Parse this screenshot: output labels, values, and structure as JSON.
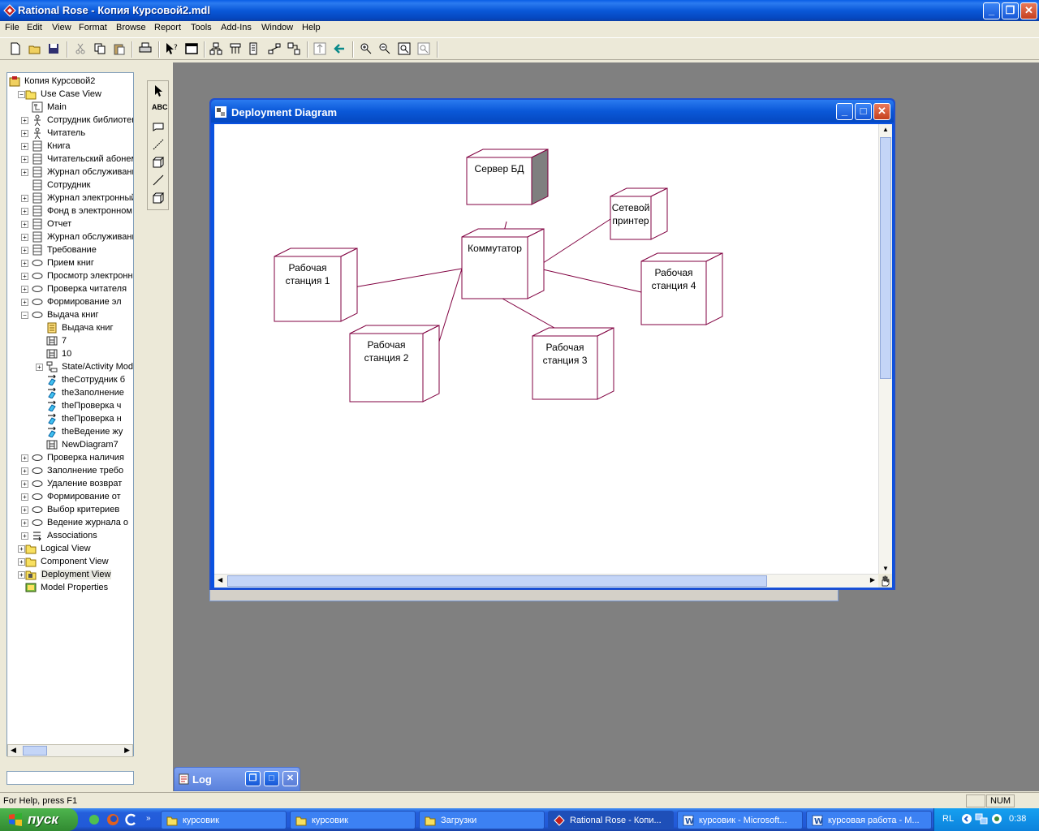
{
  "window": {
    "title": "Rational Rose - Копия Курсовой2.mdl"
  },
  "menu": [
    "File",
    "Edit",
    "View",
    "Format",
    "Browse",
    "Report",
    "Tools",
    "Add-Ins",
    "Window",
    "Help"
  ],
  "browser": {
    "items": [
      {
        "label": "Копия Курсовой2",
        "level": 0,
        "icon": "model-icon",
        "expander": ""
      },
      {
        "label": "Use Case View",
        "level": 1,
        "icon": "folder-icon",
        "expander": "−"
      },
      {
        "label": "Main",
        "level": 2,
        "icon": "diagram-icon",
        "expander": ""
      },
      {
        "label": "Сотрудник библиотеки",
        "level": 2,
        "icon": "actor-icon",
        "expander": "+"
      },
      {
        "label": "Читатель",
        "level": 2,
        "icon": "actor-icon",
        "expander": "+"
      },
      {
        "label": "Книга",
        "level": 2,
        "icon": "class-icon",
        "expander": "+"
      },
      {
        "label": "Читательский абонемент",
        "level": 2,
        "icon": "class-icon",
        "expander": "+"
      },
      {
        "label": "Журнал обслуживания",
        "level": 2,
        "icon": "class-icon",
        "expander": "+"
      },
      {
        "label": "Сотрудник",
        "level": 2,
        "icon": "class-icon",
        "expander": ""
      },
      {
        "label": "Журнал электронный",
        "level": 2,
        "icon": "class-icon",
        "expander": "+"
      },
      {
        "label": "Фонд в электронном",
        "level": 2,
        "icon": "class-icon",
        "expander": "+"
      },
      {
        "label": "Отчет",
        "level": 2,
        "icon": "class-icon",
        "expander": "+"
      },
      {
        "label": "Журнал обслуживания",
        "level": 2,
        "icon": "class-icon",
        "expander": "+"
      },
      {
        "label": "Требование",
        "level": 2,
        "icon": "class-icon",
        "expander": "+"
      },
      {
        "label": "Прием книг",
        "level": 2,
        "icon": "usecase-icon",
        "expander": "+"
      },
      {
        "label": "Просмотр электронного",
        "level": 2,
        "icon": "usecase-icon",
        "expander": "+"
      },
      {
        "label": "Проверка читателя",
        "level": 2,
        "icon": "usecase-icon",
        "expander": "+"
      },
      {
        "label": "Формирование эл",
        "level": 2,
        "icon": "usecase-icon",
        "expander": "+"
      },
      {
        "label": "Выдача книг",
        "level": 2,
        "icon": "usecase-icon",
        "expander": "−"
      },
      {
        "label": "Выдача книг",
        "level": 3,
        "icon": "doc-icon",
        "expander": ""
      },
      {
        "label": "7",
        "level": 3,
        "icon": "sequence-icon",
        "expander": ""
      },
      {
        "label": "10",
        "level": 3,
        "icon": "sequence-icon",
        "expander": ""
      },
      {
        "label": "State/Activity Model",
        "level": 3,
        "icon": "state-icon",
        "expander": "+"
      },
      {
        "label": "theСотрудник б",
        "level": 3,
        "icon": "link-icon",
        "expander": ""
      },
      {
        "label": "theЗаполнение",
        "level": 3,
        "icon": "link-icon",
        "expander": ""
      },
      {
        "label": "theПроверка ч",
        "level": 3,
        "icon": "link-icon",
        "expander": ""
      },
      {
        "label": "theПроверка н",
        "level": 3,
        "icon": "link-icon",
        "expander": ""
      },
      {
        "label": "theВедение жу",
        "level": 3,
        "icon": "link-icon",
        "expander": ""
      },
      {
        "label": "NewDiagram7",
        "level": 3,
        "icon": "sequence-icon",
        "expander": ""
      },
      {
        "label": "Проверка наличия",
        "level": 2,
        "icon": "usecase-icon",
        "expander": "+"
      },
      {
        "label": "Заполнение требо",
        "level": 2,
        "icon": "usecase-icon",
        "expander": "+"
      },
      {
        "label": "Удаление возврат",
        "level": 2,
        "icon": "usecase-icon",
        "expander": "+"
      },
      {
        "label": "Формирование от",
        "level": 2,
        "icon": "usecase-icon",
        "expander": "+"
      },
      {
        "label": "Выбор критериев",
        "level": 2,
        "icon": "usecase-icon",
        "expander": "+"
      },
      {
        "label": "Ведение журнала о",
        "level": 2,
        "icon": "usecase-icon",
        "expander": "+"
      },
      {
        "label": "Associations",
        "level": 2,
        "icon": "association-icon",
        "expander": "+"
      },
      {
        "label": "Logical View",
        "level": 1,
        "icon": "folder-icon",
        "expander": "+"
      },
      {
        "label": "Component View",
        "level": 1,
        "icon": "folder-icon",
        "expander": "+"
      },
      {
        "label": "Deployment View",
        "level": 1,
        "icon": "deploy-folder-icon",
        "expander": "+"
      },
      {
        "label": "Model Properties",
        "level": 1,
        "icon": "properties-icon",
        "expander": ""
      }
    ]
  },
  "palette": {
    "text_tool": "ABC"
  },
  "diagram": {
    "title": "Deployment Diagram",
    "nodes": [
      {
        "id": "server",
        "line1": "Сервер БД",
        "line2": "",
        "filled": true
      },
      {
        "id": "printer",
        "line1": "Сетевой",
        "line2": "принтер",
        "filled": false
      },
      {
        "id": "switch",
        "line1": "Коммутатор",
        "line2": "",
        "filled": false
      },
      {
        "id": "ws1",
        "line1": "Рабочая",
        "line2": "станция 1",
        "filled": false
      },
      {
        "id": "ws4",
        "line1": "Рабочая",
        "line2": "станция 4",
        "filled": false
      },
      {
        "id": "ws2",
        "line1": "Рабочая",
        "line2": "станция 2",
        "filled": false
      },
      {
        "id": "ws3",
        "line1": "Рабочая",
        "line2": "станция 3",
        "filled": false
      }
    ],
    "connections": [
      [
        "switch",
        "server"
      ],
      [
        "switch",
        "printer"
      ],
      [
        "switch",
        "ws1"
      ],
      [
        "switch",
        "ws2"
      ],
      [
        "switch",
        "ws3"
      ],
      [
        "switch",
        "ws4"
      ]
    ]
  },
  "log": {
    "title": "Log"
  },
  "status": {
    "help": "For Help, press F1",
    "num": "NUM"
  },
  "taskbar": {
    "start": "пуск",
    "tasks": [
      {
        "label": "курсовик",
        "icon": "folder-icon",
        "active": false
      },
      {
        "label": "курсовик",
        "icon": "folder-icon",
        "active": false
      },
      {
        "label": "Загрузки",
        "icon": "folder-icon",
        "active": false
      },
      {
        "label": "Rational Rose - Копи...",
        "icon": "rose-icon",
        "active": true
      },
      {
        "label": "курсовик - Microsoft...",
        "icon": "word-icon",
        "active": false
      },
      {
        "label": "курсовая работа - М...",
        "icon": "word-icon",
        "active": false
      }
    ],
    "lang": "RL",
    "clock": "0:38"
  },
  "colors": {
    "node_stroke": "#800040",
    "server_shade": "#7f7f7f",
    "titlebar": "#0a58d8",
    "mdi_bg": "#808080"
  }
}
